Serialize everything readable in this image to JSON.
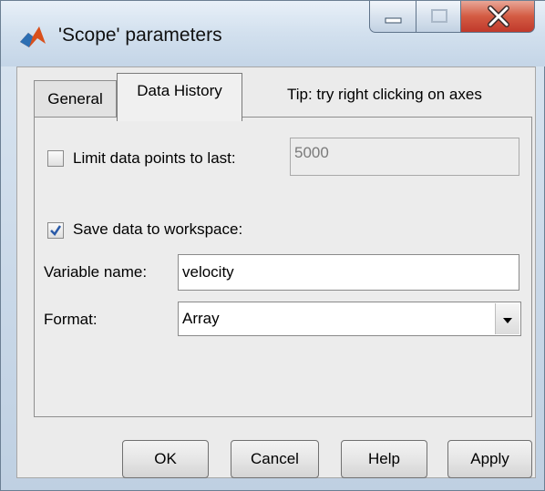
{
  "window": {
    "title": "'Scope' parameters",
    "controls": {
      "minimize": "minimize-icon",
      "maximize": "maximize-icon",
      "close": "close-icon"
    }
  },
  "tabs": [
    {
      "label": "General",
      "selected": false
    },
    {
      "label": "Data History",
      "selected": true
    }
  ],
  "tip": "Tip: try right clicking on axes",
  "limit": {
    "label": "Limit data points to last:",
    "checked": false,
    "value": "5000"
  },
  "save": {
    "label": "Save data to workspace:",
    "checked": true
  },
  "variable": {
    "label": "Variable name:",
    "value": "velocity"
  },
  "format": {
    "label": "Format:",
    "value": "Array"
  },
  "buttons": {
    "ok": "OK",
    "cancel": "Cancel",
    "help": "Help",
    "apply": "Apply"
  },
  "colors": {
    "close_button": "#c8432f",
    "check_mark": "#2a5aa8",
    "app_icon": "#d9501c"
  }
}
